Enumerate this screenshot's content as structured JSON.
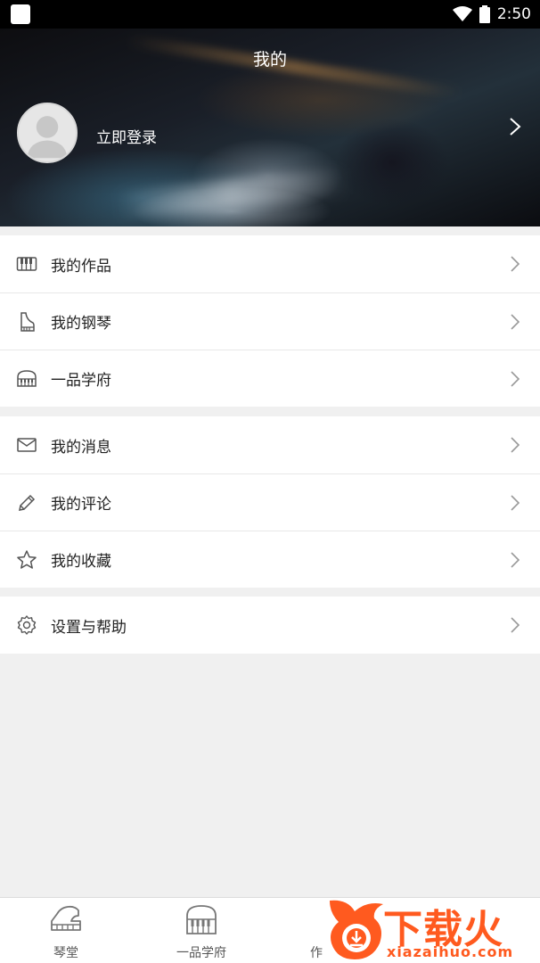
{
  "status_bar": {
    "time": "2:50"
  },
  "header": {
    "title": "我的",
    "login_text": "立即登录"
  },
  "menu_groups": [
    {
      "items": [
        {
          "label": "我的作品",
          "icon": "piano-keys-icon"
        },
        {
          "label": "我的钢琴",
          "icon": "piano-icon"
        },
        {
          "label": "一品学府",
          "icon": "grand-piano-icon"
        }
      ]
    },
    {
      "items": [
        {
          "label": "我的消息",
          "icon": "mail-icon"
        },
        {
          "label": "我的评论",
          "icon": "pencil-icon"
        },
        {
          "label": "我的收藏",
          "icon": "star-icon"
        }
      ]
    },
    {
      "items": [
        {
          "label": "设置与帮助",
          "icon": "gear-icon"
        }
      ]
    }
  ],
  "bottom_nav": [
    {
      "label": "琴堂",
      "icon": "piano-icon"
    },
    {
      "label": "一品学府",
      "icon": "grand-piano-icon"
    },
    {
      "label": "作",
      "icon": "works-icon"
    }
  ],
  "watermark": {
    "text": "下载火",
    "sub": "xiazaihuo.com"
  },
  "colors": {
    "accent": "#ff5a1f",
    "background": "#f0f0f0"
  }
}
